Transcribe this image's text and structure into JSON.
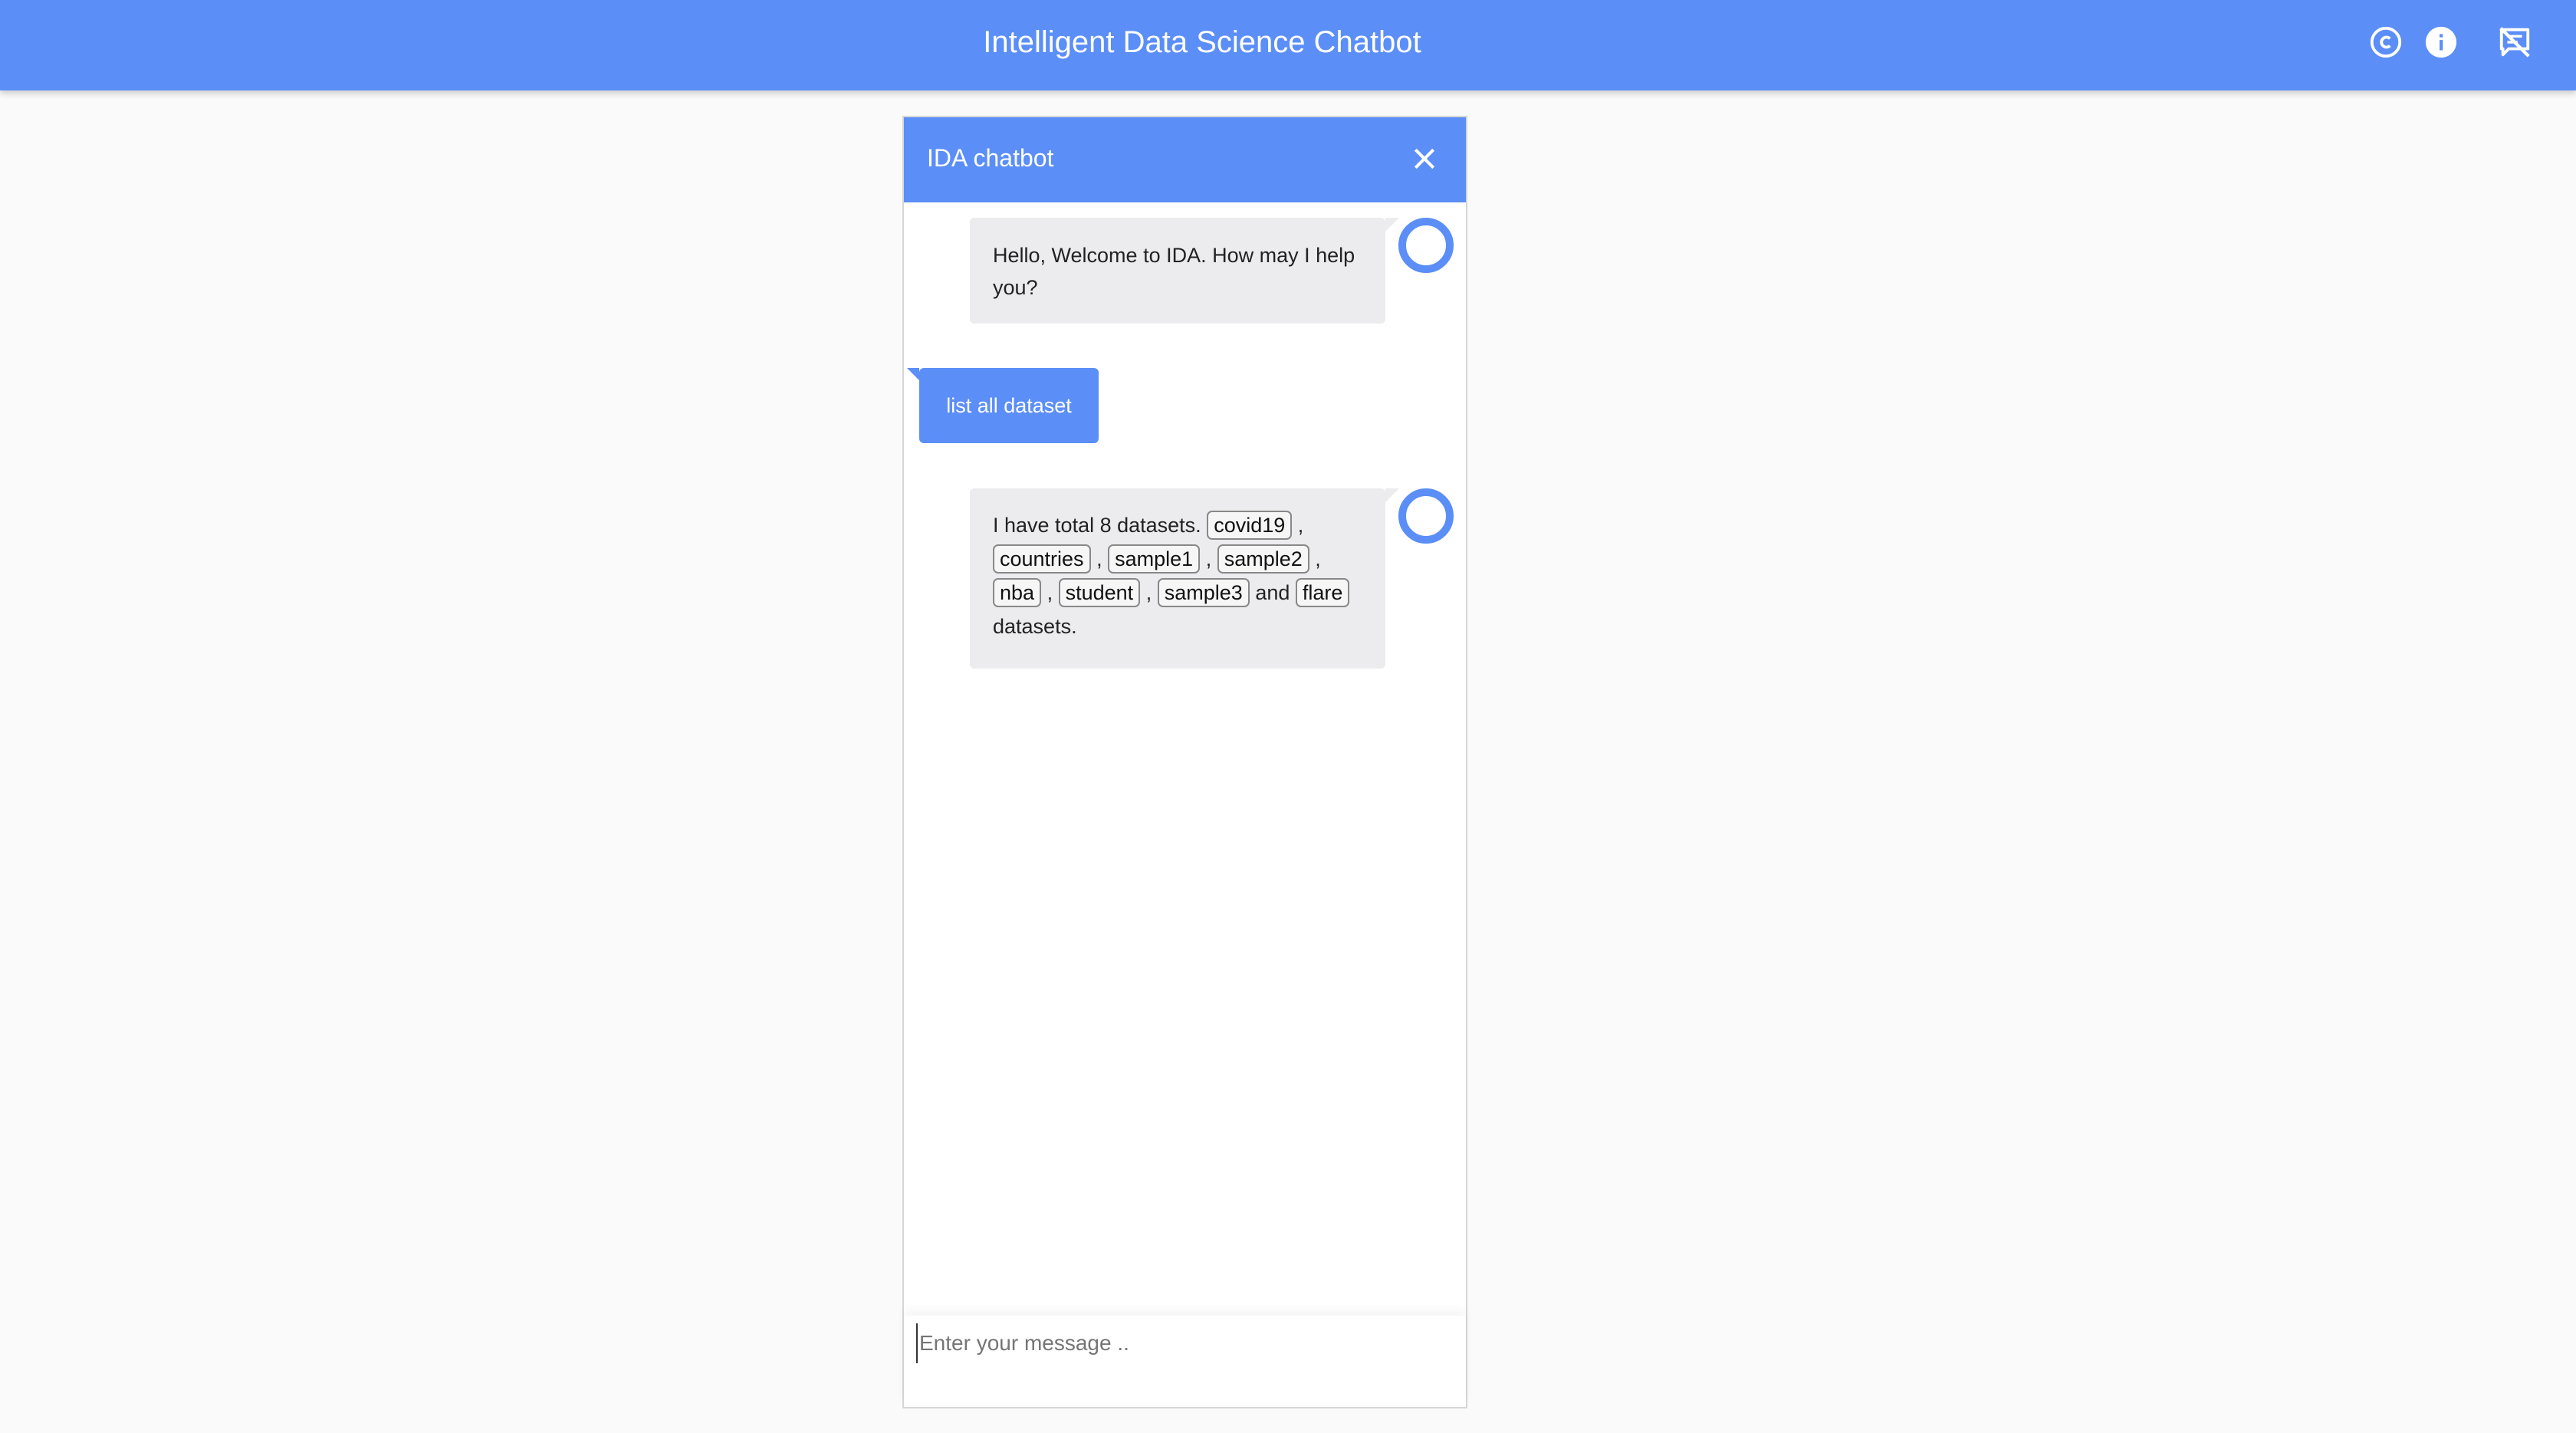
{
  "header": {
    "title": "Intelligent Data Science Chatbot",
    "icons": [
      "copyright-icon",
      "info-icon",
      "speaker-notes-off-icon"
    ],
    "color": "#5b8ef7"
  },
  "chat": {
    "title": "IDA chatbot",
    "messages": {
      "welcome": "Hello, Welcome to IDA. How may I help you?",
      "user_query": "list all dataset",
      "datasets_intro": "I have total 8 datasets.",
      "datasets": [
        "covid19",
        "countries",
        "sample1",
        "sample2",
        "nba",
        "student",
        "sample3",
        "flare"
      ],
      "separator": ",",
      "conjunction": "and",
      "suffix": "datasets."
    },
    "input": {
      "placeholder": "Enter your message ..",
      "value": ""
    }
  }
}
